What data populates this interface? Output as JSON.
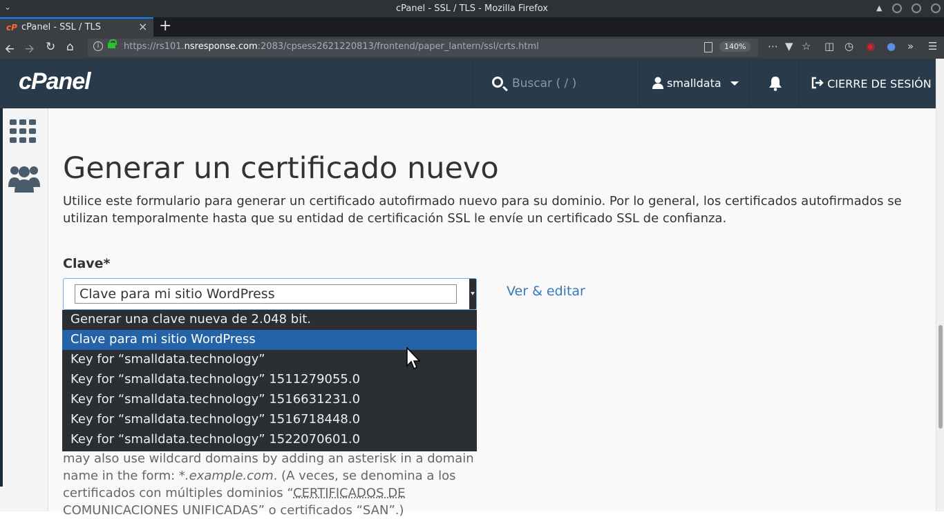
{
  "window": {
    "title": "cPanel - SSL / TLS - Mozilla Firefox"
  },
  "browser": {
    "tab_title": "cPanel - SSL / TLS",
    "tab_favicon": "cP",
    "url_host": "https://rs101.",
    "url_domain": "nsresponse.com",
    "url_rest": ":2083/cpsess2621220813/frontend/paper_lantern/ssl/crts.html",
    "zoom": "140%"
  },
  "header": {
    "logo": "cPanel",
    "search_placeholder": "Buscar ( / )",
    "username": "smalldata",
    "logout_label": "CIERRE DE SESIÓN"
  },
  "main": {
    "title": "Generar un certificado nuevo",
    "description": "Utilice este formulario para generar un certificado autofirmado nuevo para su dominio. Por lo general, los certificados autofirmados se utilizan temporalmente hasta que su entidad de certificación SSL le envíe un certificado SSL de confianza.",
    "key_label": "Clave*",
    "key_selected": "Clave para mi sitio WordPress",
    "edit_link": "Ver & editar",
    "help_line1": "may also use wildcard domains by adding an asterisk in a domain",
    "help_line2_pre": "name in the form: ",
    "help_line2_em": "*.example.com",
    "help_line2_post": ". (A veces, se denomina a los",
    "help_line3_pre": "certificados con múltiples dominios “",
    "help_line3_link": "CERTIFICADOS DE",
    "help_line4": "COMUNICACIONES UNIFICADAS” o certificados “SAN”.)"
  },
  "dropdown": {
    "options": [
      "Generar una clave nueva de 2.048 bit.",
      "Clave para mi sitio WordPress",
      "Key for “smalldata.technology”",
      "Key for “smalldata.technology” 1511279055.0",
      "Key for “smalldata.technology” 1516631231.0",
      "Key for “smalldata.technology” 1516718448.0",
      "Key for “smalldata.technology” 1522070601.0"
    ],
    "selected_index": 1
  },
  "colors": {
    "header_bg": "#293a4a",
    "link": "#337ab7",
    "dropdown_bg": "#2b2e33",
    "dropdown_selected": "#2463a7"
  }
}
